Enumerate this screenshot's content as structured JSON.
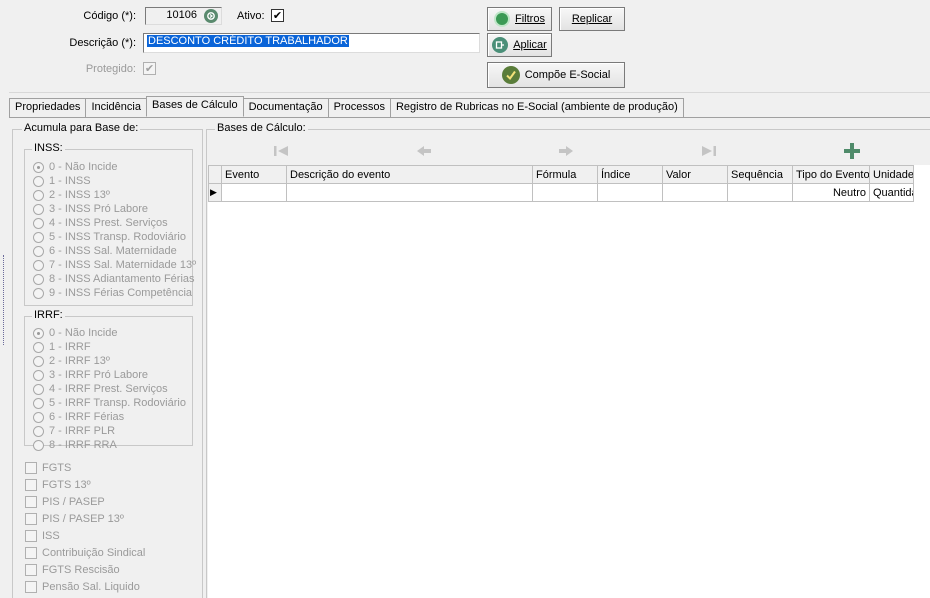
{
  "form": {
    "codigo_label": "Código (*):",
    "codigo_value": "10106",
    "ativo_label": "Ativo:",
    "ativo_checked": "✔",
    "descricao_label": "Descrição (*):",
    "descricao_value": "DESCONTO CRÉDITO TRABALHADOR",
    "protegido_label": "Protegido:",
    "protegido_checked": "✔"
  },
  "buttons": {
    "filtros": "Filtros",
    "aplicar": "Aplicar",
    "replicar": "Replicar",
    "compoe": "Compõe E-Social"
  },
  "tabs": [
    {
      "label": "Propriedades"
    },
    {
      "label": "Incidência"
    },
    {
      "label": "Bases de Cálculo"
    },
    {
      "label": "Documentação"
    },
    {
      "label": "Processos"
    },
    {
      "label": "Registro de Rubricas no E-Social (ambiente de produção)"
    }
  ],
  "left_panel": {
    "title": "Acumula para Base de:",
    "inss": {
      "title": "INSS:",
      "options": [
        "0 - Não Incide",
        "1 - INSS",
        "2 - INSS 13º",
        "3 - INSS Pró Labore",
        "4 - INSS Prest. Serviços",
        "5 - INSS Transp. Rodoviário",
        "6 - INSS Sal. Maternidade",
        "7 - INSS Sal. Maternidade 13º",
        "8 - INSS Adiantamento Férias",
        "9 - INSS Férias Competência"
      ]
    },
    "irrf": {
      "title": "IRRF:",
      "options": [
        "0 - Não Incide",
        "1 - IRRF",
        "2 - IRRF 13º",
        "3 - IRRF Pró Labore",
        "4 - IRRF Prest. Serviços",
        "5 - IRRF Transp. Rodoviário",
        "6 - IRRF Férias",
        "7 - IRRF PLR",
        "8 - IRRF RRA"
      ]
    },
    "checks": [
      "FGTS",
      "FGTS 13º",
      "PIS / PASEP",
      "PIS / PASEP 13º",
      "ISS",
      "Contribuição Sindical",
      "FGTS Rescisão",
      "Pensão Sal. Liquido"
    ]
  },
  "bases": {
    "title": "Bases de Cálculo:",
    "columns": [
      "Evento",
      "Descrição do evento",
      "Fórmula",
      "Índice",
      "Valor",
      "Sequência",
      "Tipo do Evento",
      "Unidade"
    ],
    "row": {
      "indicator": "▶",
      "evento": "",
      "descricao": "",
      "formula": "",
      "indice": "",
      "valor": "",
      "sequencia": "",
      "tipo": "Neutro",
      "unidade": "Quantidade"
    }
  }
}
